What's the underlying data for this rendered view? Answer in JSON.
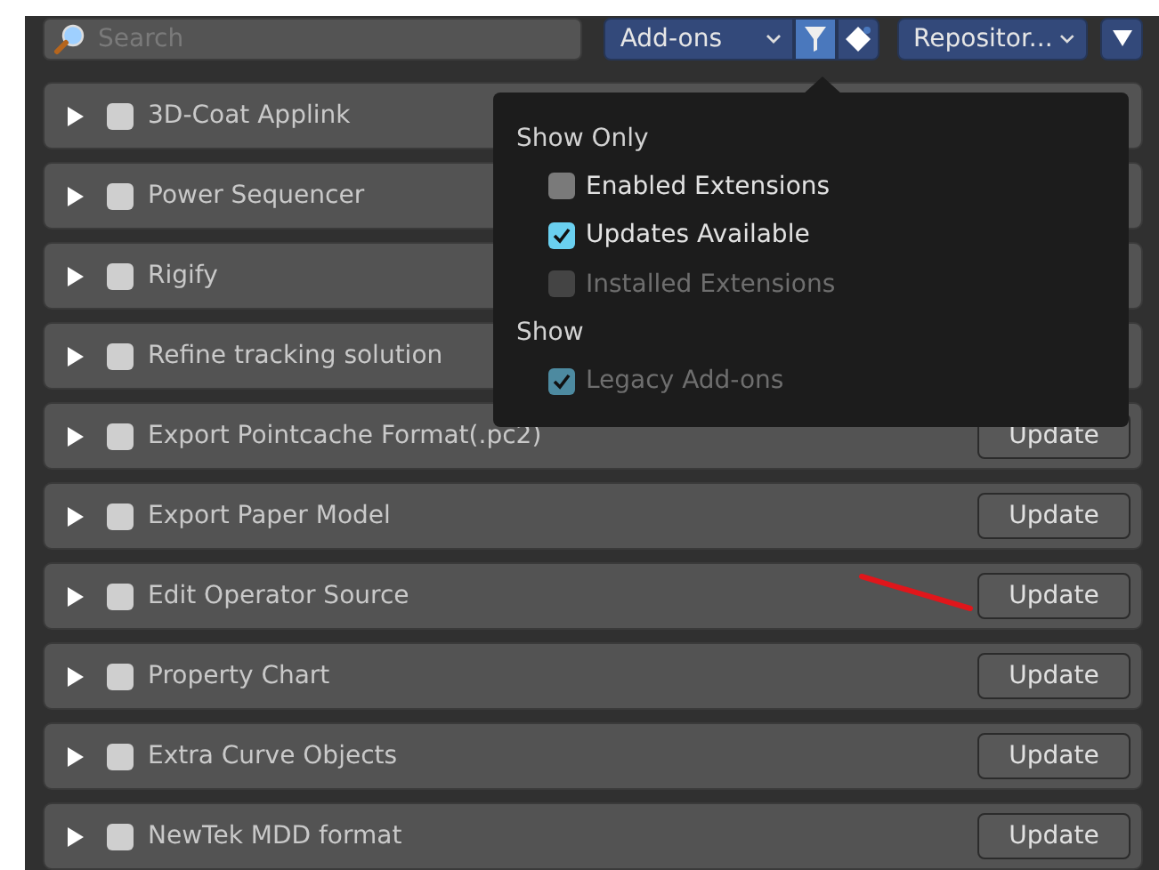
{
  "toolbar": {
    "search": {
      "placeholder": "Search"
    },
    "type_dropdown": {
      "value": "Add-ons"
    },
    "filter_button": {
      "selected": true
    },
    "repository_dropdown": {
      "value": "Repositor..."
    }
  },
  "addons": [
    {
      "name": "3D-Coat Applink",
      "checked": false,
      "expanded": false
    },
    {
      "name": "Power Sequencer",
      "checked": false,
      "expanded": false
    },
    {
      "name": "Rigify",
      "checked": false,
      "expanded": false
    },
    {
      "name": "Refine tracking solution",
      "checked": false,
      "expanded": false
    },
    {
      "name": "Export Pointcache Format(.pc2)",
      "checked": false,
      "expanded": false,
      "action": "Update"
    },
    {
      "name": "Export Paper Model",
      "checked": false,
      "expanded": false,
      "action": "Update"
    },
    {
      "name": "Edit Operator Source",
      "checked": false,
      "expanded": false,
      "action": "Update"
    },
    {
      "name": "Property Chart",
      "checked": false,
      "expanded": false,
      "action": "Update"
    },
    {
      "name": "Extra Curve Objects",
      "checked": false,
      "expanded": false,
      "action": "Update"
    },
    {
      "name": "NewTek MDD format",
      "checked": false,
      "expanded": false,
      "action": "Update"
    }
  ],
  "filter_popup": {
    "sections": [
      {
        "title": "Show Only",
        "options": [
          {
            "label": "Enabled Extensions",
            "checked": false,
            "disabled": false
          },
          {
            "label": "Updates Available",
            "checked": true,
            "disabled": false
          },
          {
            "label": "Installed Extensions",
            "checked": false,
            "disabled": true
          }
        ]
      },
      {
        "title": "Show",
        "options": [
          {
            "label": "Legacy Add-ons",
            "checked": true,
            "disabled": true
          }
        ]
      }
    ]
  }
}
